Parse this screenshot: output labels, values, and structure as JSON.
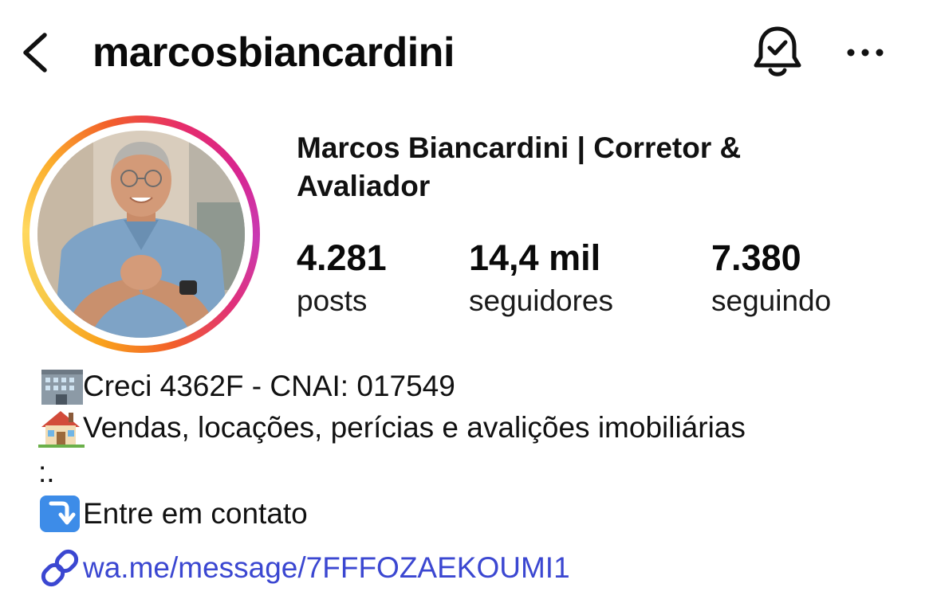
{
  "header": {
    "username": "marcosbiancardini",
    "back_icon": "chevron-left-icon",
    "notification_icon": "bell-check-icon",
    "more_icon": "more-horizontal-icon"
  },
  "profile": {
    "full_name": "Marcos Biancardini | Corretor & Avaliador",
    "stats": {
      "posts_value": "4.281",
      "posts_label": "posts",
      "followers_value": "14,4 mil",
      "followers_label": "seguidores",
      "following_value": "7.380",
      "following_label": "seguindo"
    }
  },
  "bio": {
    "line1": "Creci 4362F - CNAI: 017549",
    "line1_icon": "office-building-emoji",
    "line2": " Vendas, locações, perícias e avalições imobiliárias",
    "line2_icon": "house-emoji",
    "line3": ":.",
    "line4": " Entre em contato",
    "line4_icon": "arrow-down-right-emoji",
    "link": "wa.me/message/7FFFOZAEKOUMI1",
    "link_icon": "link-icon"
  },
  "colors": {
    "link": "#3b47d1",
    "text": "#0a0a0a",
    "story_ring_start": "#f9a11c",
    "story_ring_end": "#d8258f"
  }
}
